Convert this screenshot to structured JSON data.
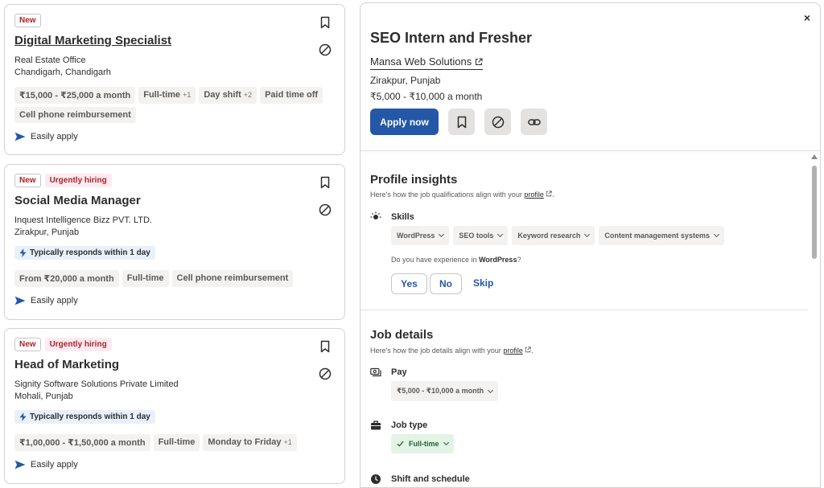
{
  "cards": [
    {
      "badges": {
        "new": "New",
        "urgent": ""
      },
      "title": "Digital Marketing Specialist",
      "company": "Real Estate Office",
      "location": "Chandigarh, Chandigarh",
      "responds": "",
      "tags": [
        {
          "text": "₹15,000 - ₹25,000 a month",
          "plus": ""
        },
        {
          "text": "Full-time",
          "plus": "+1"
        },
        {
          "text": "Day shift",
          "plus": "+2"
        },
        {
          "text": "Paid time off",
          "plus": ""
        },
        {
          "text": "Cell phone reimbursement",
          "plus": ""
        }
      ],
      "easily_apply": "Easily apply"
    },
    {
      "badges": {
        "new": "New",
        "urgent": "Urgently hiring"
      },
      "title": "Social Media Manager",
      "company": "Inquest Intelligence Bizz PVT. LTD.",
      "location": "Zirakpur, Punjab",
      "responds": "Typically responds within 1 day",
      "tags": [
        {
          "text": "From ₹20,000 a month",
          "plus": ""
        },
        {
          "text": "Full-time",
          "plus": ""
        },
        {
          "text": "Cell phone reimbursement",
          "plus": ""
        }
      ],
      "easily_apply": "Easily apply"
    },
    {
      "badges": {
        "new": "New",
        "urgent": "Urgently hiring"
      },
      "title": "Head of Marketing",
      "company": "Signity Software Solutions Private Limited",
      "location": "Mohali, Punjab",
      "responds": "Typically responds within 1 day",
      "tags": [
        {
          "text": "₹1,00,000 - ₹1,50,000 a month",
          "plus": ""
        },
        {
          "text": "Full-time",
          "plus": ""
        },
        {
          "text": "Monday to Friday",
          "plus": "+1"
        }
      ],
      "easily_apply": "Easily apply"
    }
  ],
  "detail": {
    "close": "×",
    "title": "SEO Intern and Fresher",
    "company": "Mansa Web Solutions",
    "location": "Zirakpur, Punjab",
    "salary": "₹5,000 - ₹10,000 a month",
    "apply_label": "Apply now"
  },
  "profile_insights": {
    "title": "Profile insights",
    "subtitle_pre": "Here's how the job qualifications align with your",
    "subtitle_link": "profile",
    "skills_label": "Skills",
    "skills": [
      "WordPress",
      "SEO tools",
      "Keyword research",
      "Content management systems"
    ],
    "question_pre": "Do you have experience in",
    "question_skill": "WordPress",
    "question_post": "?",
    "yes": "Yes",
    "no": "No",
    "skip": "Skip"
  },
  "job_details": {
    "title": "Job details",
    "subtitle_pre": "Here's how the job details align with your",
    "subtitle_link": "profile",
    "pay_label": "Pay",
    "pay_value": "₹5,000 - ₹10,000 a month",
    "job_type_label": "Job type",
    "job_type_value": "Full-time",
    "shift_label": "Shift and schedule"
  },
  "colors": {
    "accent": "#2557a7",
    "urgent_text": "#a9252b",
    "success": "#1f662c"
  }
}
